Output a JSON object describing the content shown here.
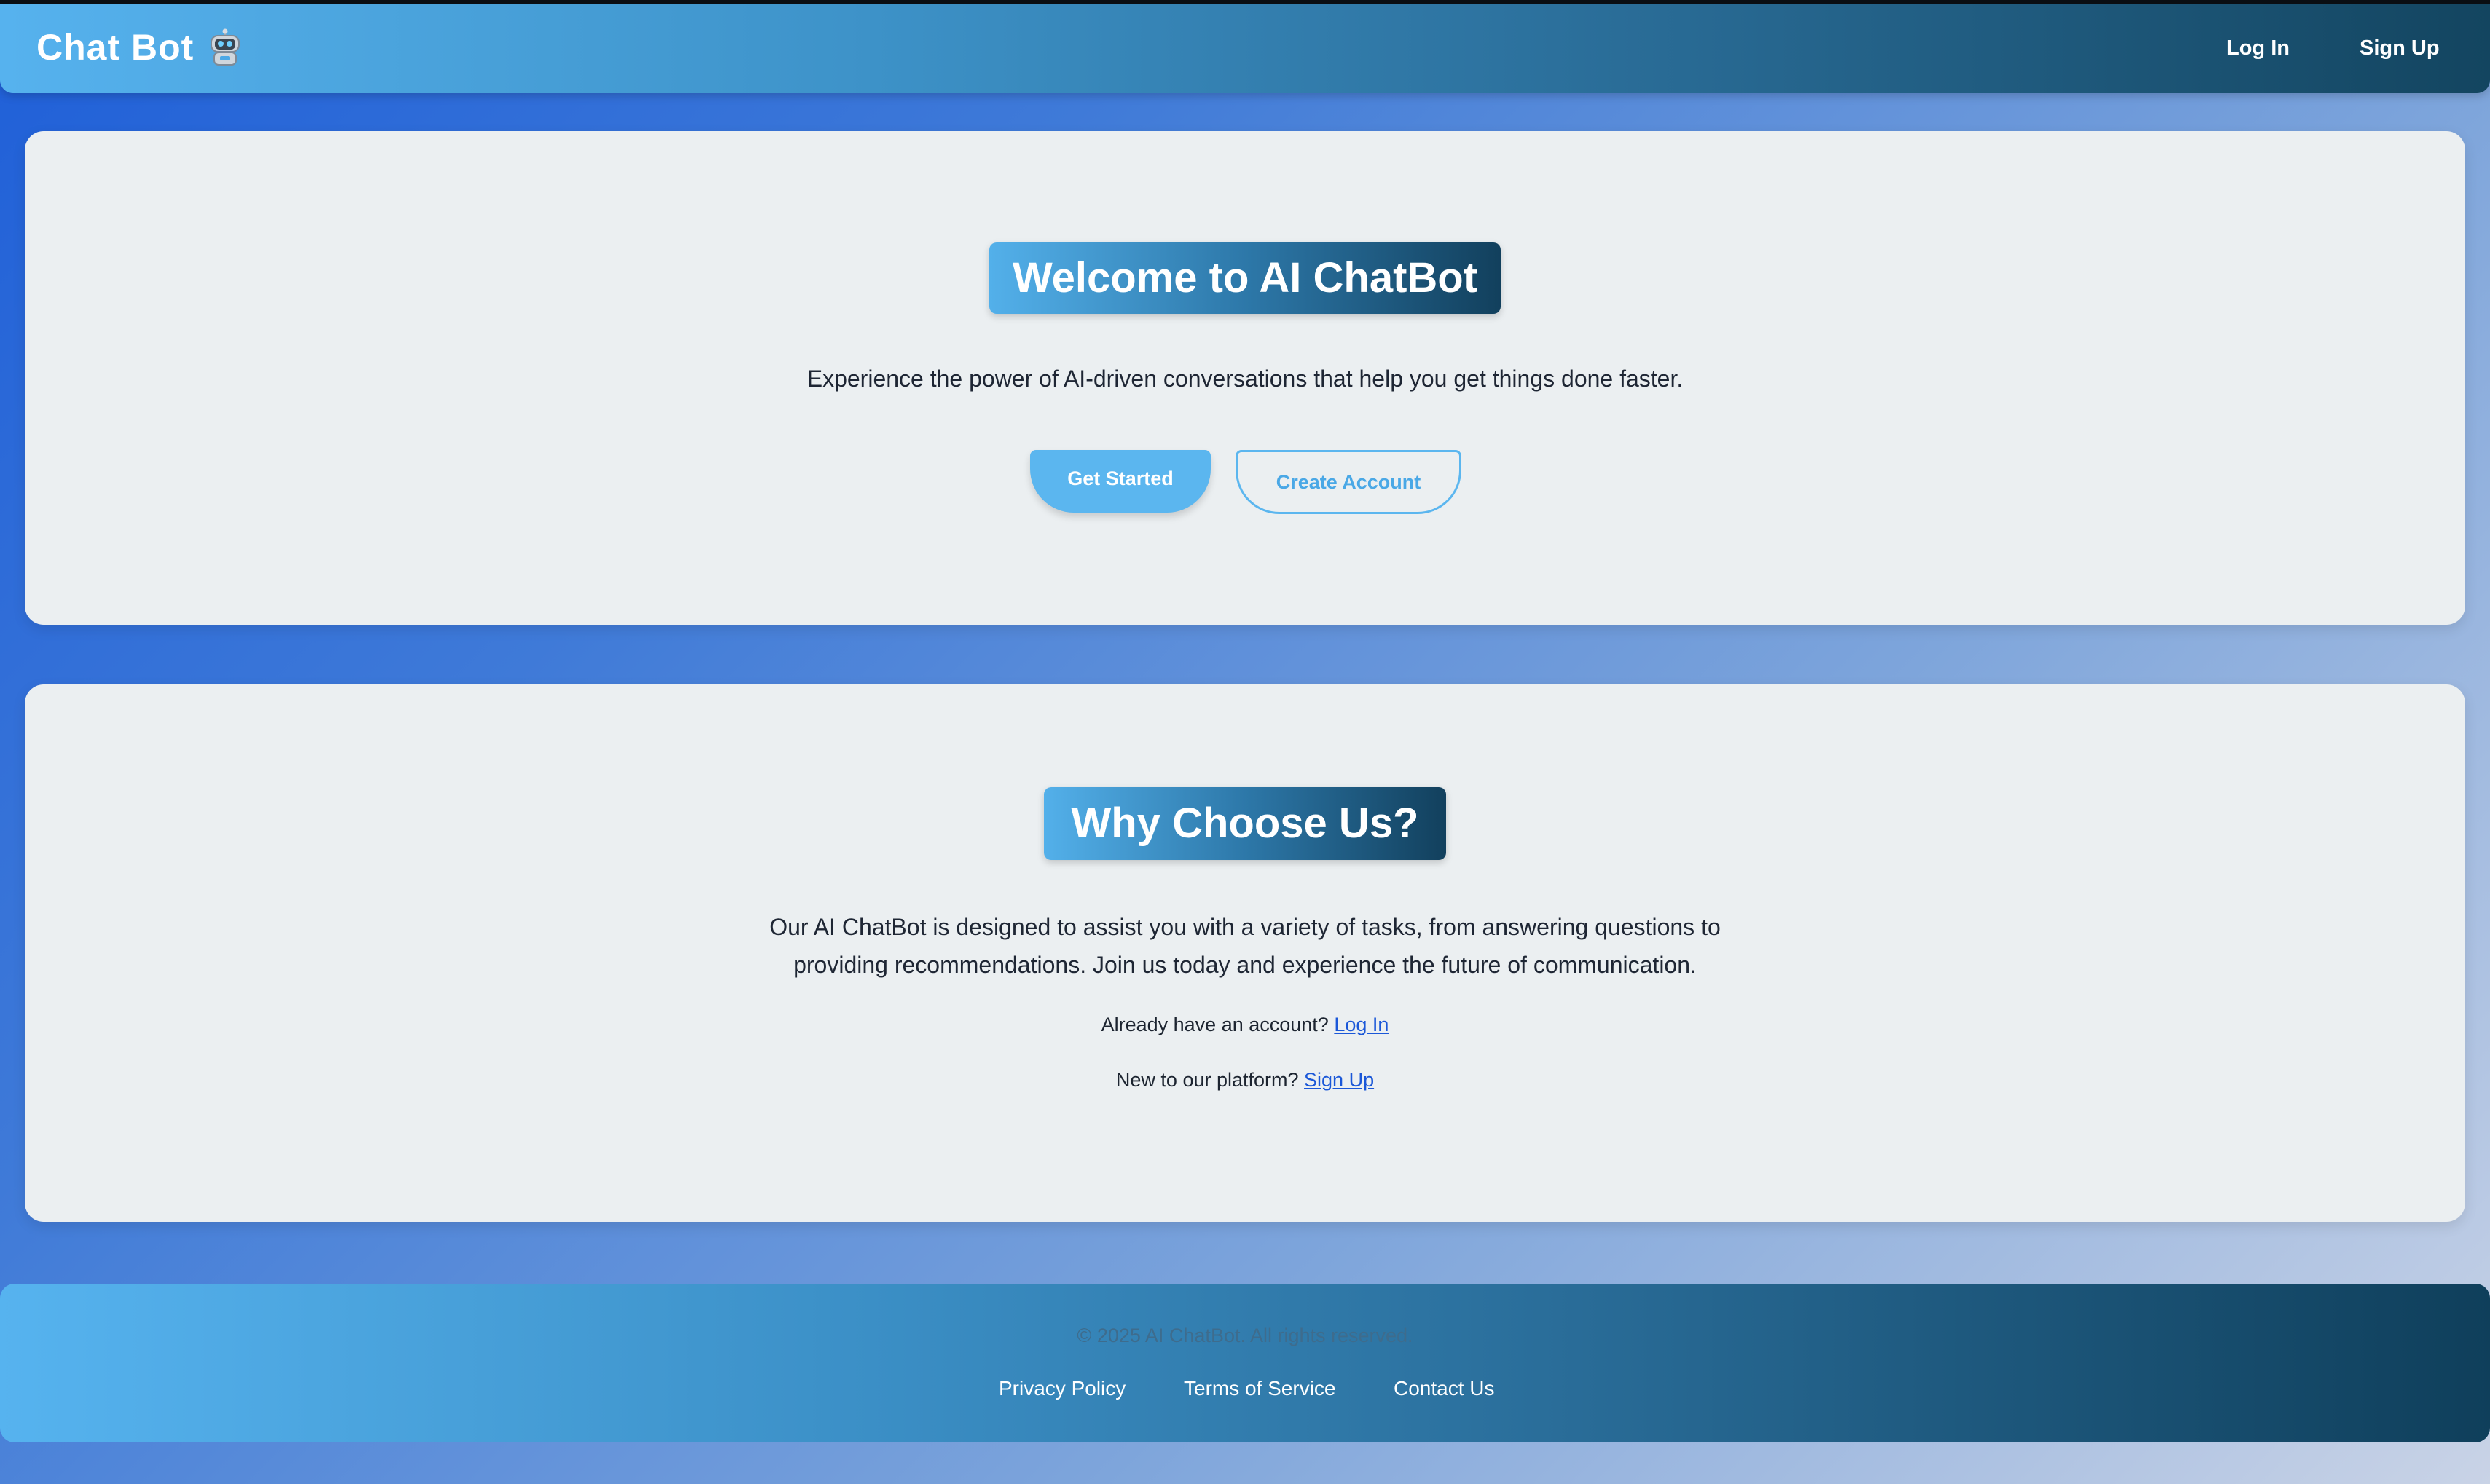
{
  "navbar": {
    "brand": "Chat Bot",
    "brand_icon": "robot-icon",
    "login_label": "Log In",
    "signup_label": "Sign Up"
  },
  "hero": {
    "title": "Welcome to AI ChatBot",
    "subtitle": "Experience the power of AI-driven conversations that help you get things done faster.",
    "primary_button": "Get Started",
    "secondary_button": "Create Account"
  },
  "features": {
    "title": "Why Choose Us?",
    "description": "Our AI ChatBot is designed to assist you with a variety of tasks, from answering questions to providing recommendations. Join us today and experience the future of communication.",
    "account_prompt": "Already have an account?",
    "account_link": "Log In",
    "new_prompt": "New to our platform?",
    "new_link": "Sign Up"
  },
  "footer": {
    "copyright": "© 2025 AI ChatBot. All rights reserved.",
    "links": [
      "Privacy Policy",
      "Terms of Service",
      "Contact Us"
    ]
  },
  "colors": {
    "accent": "#5bb6ef",
    "navbar_start": "#56b2ee",
    "navbar_end": "#134560",
    "card_bg": "#ebeff1",
    "link": "#1a57d8"
  }
}
